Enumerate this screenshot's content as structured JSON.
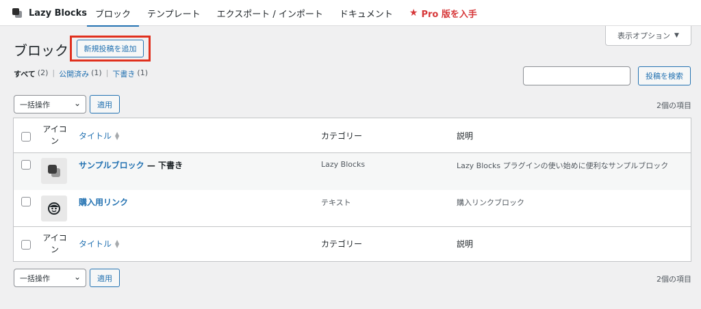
{
  "topbar": {
    "brand": "Lazy Blocks",
    "tabs": [
      {
        "label": "ブロック",
        "active": true
      },
      {
        "label": "テンプレート"
      },
      {
        "label": "エクスポート / インポート"
      },
      {
        "label": "ドキュメント"
      },
      {
        "label": "Pro 版を入手",
        "icon": "star-icon",
        "color": "#d63638"
      }
    ]
  },
  "screen_options": "表示オプション",
  "page": {
    "title": "ブロック",
    "add_new": "新規投稿を追加"
  },
  "filters": {
    "all": {
      "label": "すべて",
      "count": "(2)"
    },
    "published": {
      "label": "公開済み",
      "count": "(1)"
    },
    "draft": {
      "label": "下書き",
      "count": "(1)"
    }
  },
  "search": {
    "value": "",
    "button": "投稿を検索"
  },
  "bulk": {
    "select": "一括操作",
    "apply": "適用"
  },
  "items_count": "2個の項目",
  "table": {
    "columns": {
      "icon": "アイコン",
      "title": "タイトル",
      "category": "カテゴリー",
      "description": "説明"
    },
    "rows": [
      {
        "icon": "lazy-blocks-logo-icon",
        "title": "サンプルブロック",
        "state": " — 下書き",
        "category": "Lazy Blocks",
        "description": "Lazy Blocks プラグインの使い始めに便利なサンプルブロック"
      },
      {
        "icon": "smiley-icon",
        "title": "購入用リンク",
        "state": "",
        "category": "テキスト",
        "description": "購入リンクブロック"
      }
    ]
  },
  "colors": {
    "accent": "#2271b1",
    "highlight": "#e0301e",
    "pro": "#d63638"
  }
}
